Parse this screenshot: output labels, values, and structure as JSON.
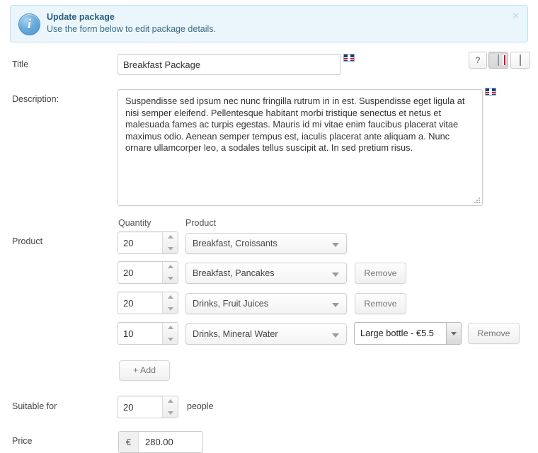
{
  "alert": {
    "title": "Update package",
    "text": "Use the form below to edit package details.",
    "close_label": "×"
  },
  "toolbar": {
    "help_label": "?",
    "lang_en_icon": "flag-uk-icon",
    "lang_de_icon": "flag-de-icon"
  },
  "form": {
    "title_label": "Title",
    "title_value": "Breakfast Package",
    "title_flag_icon": "flag-uk-icon",
    "description_label": "Description:",
    "description_value": "Suspendisse sed ipsum nec nunc fringilla rutrum in in est. Suspendisse eget ligula at nisi semper eleifend. Pellentesque habitant morbi tristique senectus et netus et malesuada fames ac turpis egestas. Mauris id mi vitae enim faucibus placerat vitae maximus odio. Aenean semper tempus est, iaculis placerat ante aliquam a. Nunc ornare ullamcorper leo, a sodales tellus suscipit at. In sed pretium risus.",
    "description_flag_icon": "flag-uk-icon",
    "product_label": "Product",
    "quantity_col_header": "Quantity",
    "product_col_header": "Product",
    "rows": [
      {
        "quantity": "20",
        "product": "Breakfast, Croissants",
        "variant": null,
        "remove_label": null
      },
      {
        "quantity": "20",
        "product": "Breakfast, Pancakes",
        "variant": null,
        "remove_label": "Remove"
      },
      {
        "quantity": "20",
        "product": "Drinks, Fruit Juices",
        "variant": null,
        "remove_label": "Remove"
      },
      {
        "quantity": "10",
        "product": "Drinks, Mineral Water",
        "variant": "Large bottle - €5.5",
        "remove_label": "Remove"
      }
    ],
    "add_label": "+ Add",
    "suitable_label": "Suitable for",
    "suitable_value": "20",
    "people_label": "people",
    "price_label": "Price",
    "price_currency": "€",
    "price_value": "280.00"
  },
  "colors": {
    "alert_bg": "#eaf6fb",
    "alert_border": "#bfe3f2",
    "accent_blue": "#4a90c8",
    "text": "#333333"
  }
}
